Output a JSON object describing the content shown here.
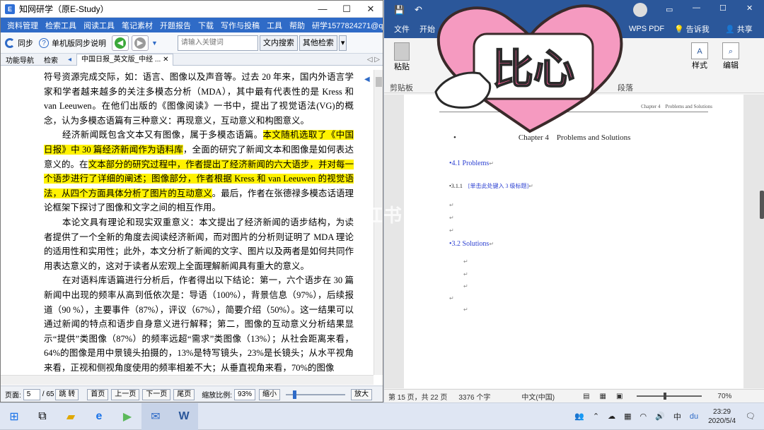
{
  "left_window": {
    "title": "知网研学（原E-Study）",
    "menu": [
      "资料管理",
      "检索工具",
      "阅读工具",
      "笔记素材",
      "开题报告",
      "下载",
      "写作与投稿",
      "工具",
      "帮助",
      "研学1577824271@qq..."
    ],
    "toolbar": {
      "sync_label": "同步",
      "help_label": "单机版同步说明",
      "search_placeholder": "请输入关键词",
      "in_doc_search": "文内搜索",
      "other_search": "其他检索"
    },
    "tabs": {
      "nav": "功能导航",
      "search": "检索",
      "doc": "中国日报_英文版_中经 ..."
    },
    "paragraphs": [
      {
        "plain1": "符号资源完成交际，如：语言、图像以及声音等。过去 20 年来，国内外语言学家和学者越来越多的关注多模态分析（MDA），其中最有代表性的是 Kress 和 van Leeuwen。在他们出版的《图像阅读》一书中，提出了视觉语法(VG)的概念，认为多模态语篇有三种意义：再现意义，互动意义和构图意义。",
        "hl1": "",
        "mid": "",
        "hl2": "",
        "plain2": ""
      },
      {
        "plain1": "经济新闻既包含文本又有图像，属于多模态语篇。",
        "hl1": "本文随机选取了《中国日报》中 30 篇经济新闻作为语料库",
        "mid": "，全面的研究了新闻文本和图像是如何表达意义的。在",
        "hl2": "文本部分的研究过程中，作者提出了经济新闻的六大语步，并对每一个语步进行了详细的阐述；图像部分，作者根据 Kress 和 van Leeuwen 的视觉语法，从四个方面具体分析了图片的互动意义",
        "plain2": "。最后，作者在张德禄多模态话语理论框架下探讨了图像和文字之间的相互作用。"
      },
      {
        "plain1": "本论文具有理论和现实双重意义：本文提出了经济新闻的语步结构，为读者提供了一个全新的角度去阅读经济新闻，而对图片的分析则证明了 MDA 理论的适用性和实用性；此外，本文分析了新闻的文字、图片以及两者是如何共同作用表达意义的，这对于读者从宏观上全面理解新闻具有重大的意义。",
        "hl1": "",
        "mid": "",
        "hl2": "",
        "plain2": ""
      },
      {
        "plain1": "在对语料库语篇进行分析后，作者得出以下结论：第一，六个语步在 30 篇新闻中出现的频率从高到低依次是：导语（100%），背景信息（97%），后续报道（90 %），主要事件（87%），评议（67%），简要介绍（50%）。这一结果可以通过新闻的特点和语步自身意义进行解释；第二，图像的互动意义分析结果显示“提供”类图像（87%）的频率远超“需求”类图像（13%）；从社会距离来看，64%的图像是用中景镜头拍摄的，13%是特写镜头，23%是长镜头；从水平视角来看，正视和侧视角度使用的频率相差不大；从垂直视角来看，70%的图像",
        "hl1": "",
        "mid": "",
        "hl2": "",
        "plain2": ""
      }
    ],
    "status": {
      "page_label": "页面:",
      "page_value": "5",
      "page_total": "/ 65",
      "goto": "跳 转",
      "first": "首页",
      "prev": "上一页",
      "next": "下一页",
      "last": "尾页",
      "zoom_label": "缩放比例:",
      "zoom_value": "93%",
      "zoom_out": "缩小",
      "zoom_in": "放大"
    }
  },
  "right_window": {
    "tabs": [
      "文件",
      "开始",
      "WPS PDF",
      "告诉我",
      "共享"
    ],
    "ribbon": {
      "paste": "粘贴",
      "clipboard": "剪贴板",
      "styles": "样式",
      "edit": "编辑",
      "para": "段落"
    },
    "doc": {
      "header": "Chapter 4　Problems and Solutions",
      "heading": "Chapter 4　Problems and Solutions",
      "h41": "4.1 Problems",
      "h311_num": "3.1.1",
      "h311_text": "[单击此处键入 3 级标题]",
      "h32": "3.2 Solutions"
    },
    "status": {
      "page": "第 15 页，共 22 页",
      "words": "3376 个字",
      "lang": "中文(中国)",
      "zoom": "70%"
    }
  },
  "overlay": {
    "sticker": "比心",
    "watermark": "小红书"
  },
  "taskbar": {
    "time": "23:29",
    "date": "2020/5/4",
    "ime": "中"
  },
  "colors": {
    "menu_bar": "#2f6bc7",
    "word_blue": "#2b579a",
    "highlight": "#fff200",
    "heart": "#f59ac0"
  }
}
